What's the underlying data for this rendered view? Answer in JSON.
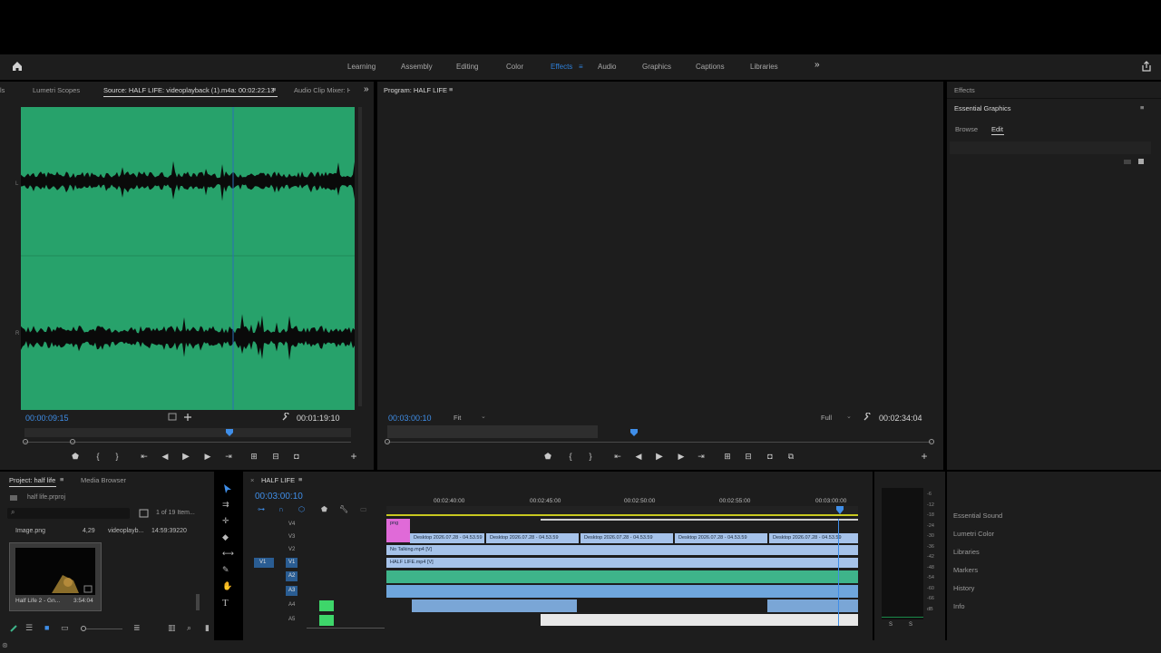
{
  "workspaces": [
    "Learning",
    "Assembly",
    "Editing",
    "Color",
    "Effects",
    "Audio",
    "Graphics",
    "Captions",
    "Libraries"
  ],
  "active_workspace": "Effects",
  "source": {
    "tabs": [
      "ls",
      "Lumetri Scopes",
      "Source: HALF LIFE: videoplayback (1).m4a: 00:02:22:13",
      "Audio Clip Mixer: H"
    ],
    "timecode_current": "00:00:09:15",
    "timecode_duration": "00:01:19:10",
    "wave_labels": [
      "L",
      "R"
    ],
    "playhead_fraction": 0.63
  },
  "program": {
    "title": "Program: HALF LIFE",
    "timecode_current": "00:03:00:10",
    "zoom": "Fit",
    "resolution": "Full",
    "timecode_duration": "00:02:34:04"
  },
  "effects": {
    "header": "Effects",
    "title": "Essential Graphics",
    "tabs": [
      "Browse",
      "Edit"
    ],
    "active_tab": "Edit"
  },
  "project": {
    "tabs": [
      "Project: half life",
      "Media Browser"
    ],
    "file": "half life.prproj",
    "item_count": "1 of 19 Item...",
    "columns": [
      "Image.png",
      "4,29",
      "videoplayb...",
      "14:59:39220"
    ],
    "thumb_name": "Half Life 2 - Gn...",
    "thumb_duration": "3:54:04"
  },
  "timeline": {
    "tab": "HALF LIFE",
    "timecode": "00:03:00:10",
    "ruler": [
      "00:02:40:00",
      "00:02:45:00",
      "00:02:50:00",
      "00:02:55:00",
      "00:03:00:00"
    ],
    "video_tracks": [
      "V4",
      "V3",
      "V2",
      "V1"
    ],
    "audio_tracks": [
      "A1",
      "A2",
      "A3",
      "A4",
      "A5"
    ],
    "clips": {
      "desktop": [
        "Desktop 2026.07.28 - 04.53.59",
        "Desktop 2026.07.28 - 04.53.59",
        "Desktop 2026.07.28 - 04.53.59",
        "Desktop 2026.07.28 - 04.53.59",
        "Desktop 2026.07.28 - 04.53.59"
      ],
      "no_talking": "No Talking.mp4 [V]",
      "half_life": "HALF LIFE.mp4 [V]",
      "png": "png"
    }
  },
  "meter": {
    "scale": [
      "-6",
      "-12",
      "-18",
      "-24",
      "-30",
      "-36",
      "-42",
      "-48",
      "-54",
      "-60",
      "-66",
      "dB"
    ],
    "solo": [
      "S",
      "S"
    ]
  },
  "right_list": [
    "Essential Sound",
    "Lumetri Color",
    "Libraries",
    "Markers",
    "History",
    "Info"
  ],
  "colors": {
    "accent": "#2e7fd8",
    "waveform_bg": "#27a26b",
    "video_clip": "#a6c3ea",
    "audio_clip": "#3eb48a",
    "pink_clip": "#e06ad8"
  }
}
